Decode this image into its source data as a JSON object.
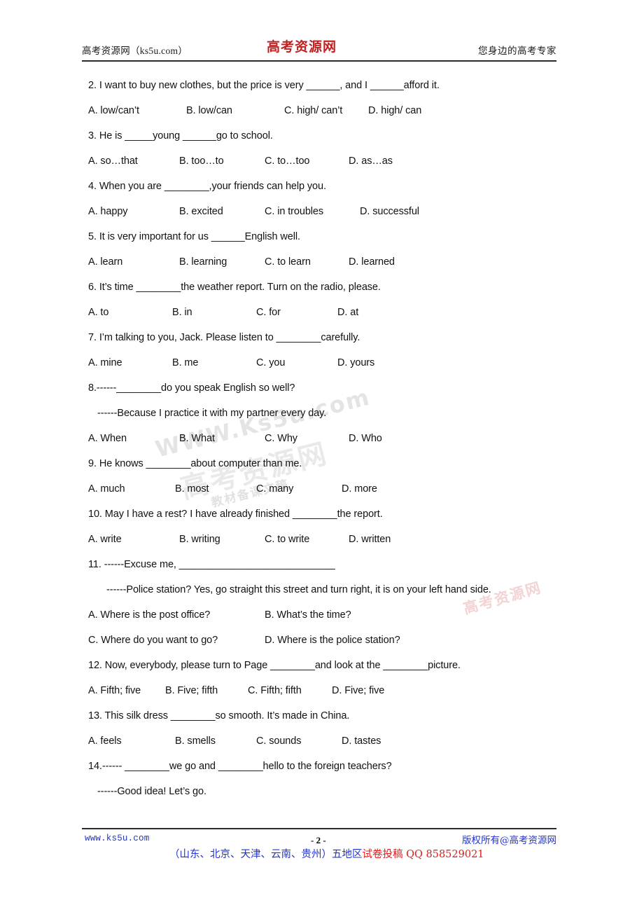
{
  "header": {
    "left": "高考资源网（ks5u.com）",
    "center_logo": "高考资源网",
    "right": "您身边的高考专家"
  },
  "questions": [
    {
      "stem": "2. I want to buy new clothes, but the price is very ______, and I ______afford it.",
      "options": [
        "A. low/can’t",
        "B. low/can",
        "C. high/ can’t",
        "D. high/ can"
      ]
    },
    {
      "stem": "3. He is _____young ______go to school.",
      "options": [
        "A. so…that",
        "B. too…to",
        "C. to…too",
        "D. as…as"
      ]
    },
    {
      "stem": "4. When you are ________,your friends can help you.",
      "options": [
        "A. happy",
        "B. excited",
        "C. in troubles",
        "D. successful"
      ]
    },
    {
      "stem": "5. It is very important for us ______English well.",
      "options": [
        "A. learn",
        "B. learning",
        "C. to learn",
        "D. learned"
      ]
    },
    {
      "stem": "6. It’s time ________the weather report. Turn on the radio, please.",
      "options": [
        "A. to",
        "B. in",
        "C. for",
        "D. at"
      ]
    },
    {
      "stem": "7. I’m talking to you, Jack. Please listen to ________carefully.",
      "options": [
        "A. mine",
        "B. me",
        "C. you",
        "D. yours"
      ]
    },
    {
      "stem": "8.------________do you speak English so well?",
      "answer_line": "------Because I practice it with my partner every day.",
      "options": [
        "A. When",
        "B. What",
        "C. Why",
        "D. Who"
      ]
    },
    {
      "stem": "9. He knows ________about computer than me.",
      "options": [
        "A. much",
        "B. most",
        "C. many",
        "D. more"
      ]
    },
    {
      "stem": "10. May I have a rest? I have already finished ________the report.",
      "options": [
        "A. write",
        "B. writing",
        "C. to write",
        "D. written"
      ]
    },
    {
      "stem": "11. ------Excuse me, ____________________________",
      "answer_line": "------Police station? Yes, go straight this street and turn right, it is on your left hand side.",
      "options_row1": [
        "A. Where is the post office?",
        "B. What’s the time?"
      ],
      "options_row2": [
        "C. Where do you want to go?",
        "D. Where is the police station?"
      ]
    },
    {
      "stem": "12. Now, everybody, please turn to Page ________and look at the ________picture.",
      "options": [
        "A. Fifth; five",
        "B. Five; fifth",
        "C. Fifth; fifth",
        "D. Five; five"
      ]
    },
    {
      "stem": "13. This silk dress ________so smooth. It’s made in China.",
      "options": [
        "A. feels",
        "B. smells",
        "C. sounds",
        "D. tastes"
      ]
    },
    {
      "stem": "14.------ ________we go and ________hello to the foreign teachers?",
      "answer_line": "------Good idea! Let’s go."
    }
  ],
  "watermark": {
    "url": "WWW.Ks5u.com",
    "brand": "高考资源网",
    "sub": "教材备课文稿",
    "red": "高考资源网"
  },
  "footer": {
    "left_url": "www.ks5u.com",
    "page_number": "- 2 -",
    "center_regions": "（山东、北京、天津、云南、贵州）五地区",
    "center_submit": "试卷投稿 QQ 858529021",
    "right": "版权所有@高考资源网"
  },
  "colors": {
    "logo_red": "#c21f1f",
    "link_blue": "#2233cc",
    "accent_red": "#e01b1b"
  }
}
